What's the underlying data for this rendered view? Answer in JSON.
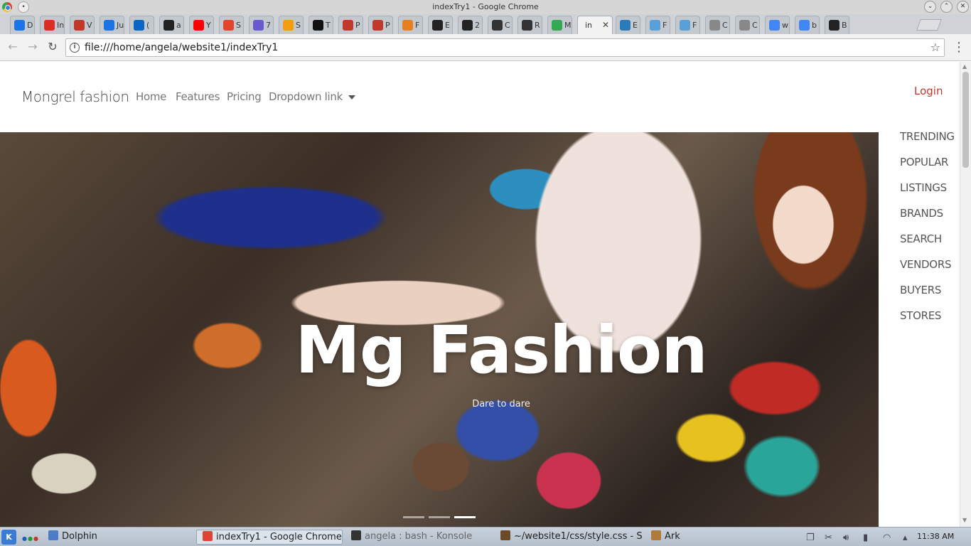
{
  "window": {
    "title": "indexTry1 - Google Chrome"
  },
  "tabs": [
    {
      "label": "D",
      "icon": "cloud-icon",
      "color": "#1a73e8"
    },
    {
      "label": "In",
      "icon": "gmail-icon",
      "color": "#d93025"
    },
    {
      "label": "V",
      "icon": "check-icon",
      "color": "#c0392b"
    },
    {
      "label": "Ju",
      "icon": "info-icon",
      "color": "#1a73e8"
    },
    {
      "label": "(",
      "icon": "linkedin-icon",
      "color": "#0a66c2"
    },
    {
      "label": "a",
      "icon": "bb-icon",
      "color": "#222222"
    },
    {
      "label": "Y",
      "icon": "youtube-icon",
      "color": "#ff0000"
    },
    {
      "label": "S",
      "icon": "m-icon",
      "color": "#e4442e"
    },
    {
      "label": "7",
      "icon": "shield-icon",
      "color": "#6a5acd"
    },
    {
      "label": "S",
      "icon": "star-icon",
      "color": "#f39c12"
    },
    {
      "label": "T",
      "icon": "medium-icon",
      "color": "#111111"
    },
    {
      "label": "P",
      "icon": "link-icon",
      "color": "#c0392b"
    },
    {
      "label": "P",
      "icon": "link-icon",
      "color": "#c0392b"
    },
    {
      "label": "F",
      "icon": "flower-icon",
      "color": "#e67e22"
    },
    {
      "label": "E",
      "icon": "diamond-icon",
      "color": "#222222"
    },
    {
      "label": "2",
      "icon": "f-icon",
      "color": "#222222"
    },
    {
      "label": "C",
      "icon": "codepen-icon",
      "color": "#333333"
    },
    {
      "label": "R",
      "icon": "codepen-icon",
      "color": "#333333"
    },
    {
      "label": "M",
      "icon": "maps-icon",
      "color": "#34a853"
    },
    {
      "label": "in",
      "icon": "none",
      "color": "#f2f2f2",
      "active": true
    },
    {
      "label": "E",
      "icon": "code-icon",
      "color": "#2b7bb9"
    },
    {
      "label": "F",
      "icon": "code-icon",
      "color": "#5aa0d8"
    },
    {
      "label": "F",
      "icon": "code-icon",
      "color": "#5aa0d8"
    },
    {
      "label": "C",
      "icon": "page-icon",
      "color": "#888888"
    },
    {
      "label": "C",
      "icon": "page-icon",
      "color": "#888888"
    },
    {
      "label": "w",
      "icon": "google-icon",
      "color": "#4285f4"
    },
    {
      "label": "b",
      "icon": "google-icon",
      "color": "#4285f4"
    },
    {
      "label": "B",
      "icon": "b-icon",
      "color": "#222222"
    }
  ],
  "address_bar": {
    "url": "file:///home/angela/website1/indexTry1"
  },
  "page": {
    "brand": "Mongrel fashion",
    "nav": {
      "home": "Home",
      "features": "Features",
      "pricing": "Pricing",
      "dropdown": "Dropdown link"
    },
    "login": "Login",
    "hero": {
      "title": "Mg Fashion",
      "subtitle": "Dare to dare",
      "slide_count": 3,
      "active_slide": 3
    },
    "side_nav": [
      "TRENDING",
      "POPULAR",
      "LISTINGS",
      "BRANDS",
      "SEARCH",
      "VENDORS",
      "BUYERS",
      "STORES"
    ]
  },
  "taskbar": {
    "tasks": [
      {
        "label": "Dolphin",
        "color": "#4a7cc7"
      },
      {
        "label": "indexTry1 - Google Chrome",
        "color": "#e34133",
        "active": true
      },
      {
        "label": "angela : bash - Konsole",
        "color": "#333333",
        "dim": true
      },
      {
        "label": "~/website1/css/style.css - S",
        "color": "#6b4a2a"
      },
      {
        "label": "Ark",
        "color": "#b07a3a"
      }
    ],
    "clock": "11:38 AM"
  }
}
